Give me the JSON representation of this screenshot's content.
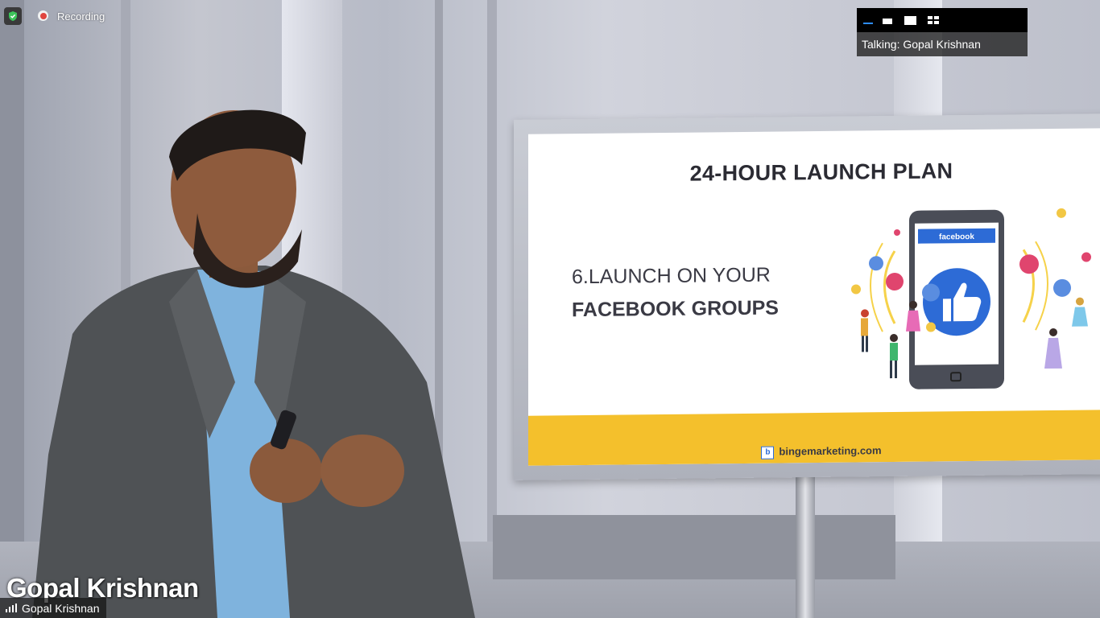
{
  "recording": {
    "label": "Recording",
    "status_color": "#e0453f"
  },
  "security": {
    "icon": "shield-check-icon",
    "color": "#3cc45a"
  },
  "view_switcher": {
    "options": [
      "minimize-view-icon",
      "thumbnail-view-icon",
      "speaker-view-icon",
      "gallery-view-icon"
    ],
    "active": "minimize-view-icon",
    "accent": "#2d8cff"
  },
  "talking_indicator": {
    "text": "Talking: Gopal Krishnan"
  },
  "slide": {
    "title": "24-HOUR LAUNCH PLAN",
    "line1": "6.LAUNCH ON YOUR",
    "line2": "FACEBOOK GROUPS",
    "phone_banner": "facebook",
    "footer": "bingemarketing.com",
    "footer_logo": "b",
    "accent_yellow": "#f4c02c",
    "accent_blue": "#2d6bd6"
  },
  "presenter_overlay": {
    "name": "Gopal Krishnan"
  },
  "participant_label": {
    "name": "Gopal Krishnan",
    "icon": "signal-bars-icon"
  }
}
